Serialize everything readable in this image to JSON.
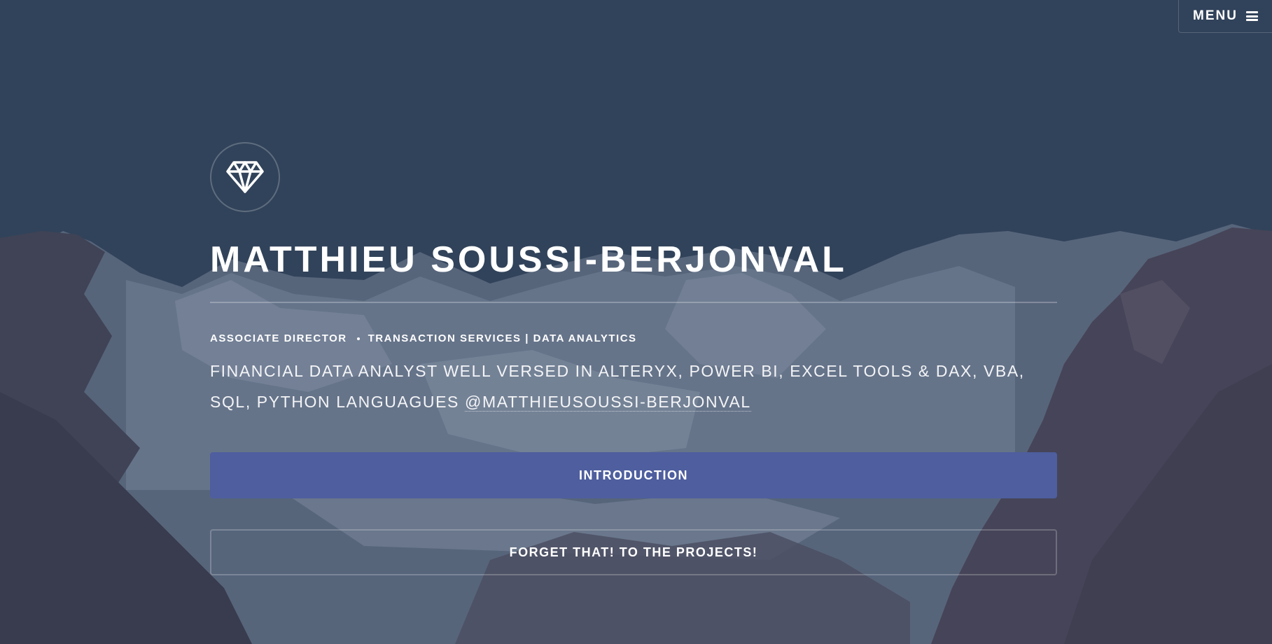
{
  "nav": {
    "menu_label": "MENU",
    "menu_icon": "hamburger-icon"
  },
  "hero": {
    "logo_icon": "diamond-icon",
    "name": "MATTHIEU SOUSSI-BERJONVAL",
    "role": "ASSOCIATE DIRECTOR",
    "department": "TRANSACTION SERVICES | DATA ANALYTICS",
    "description_text": "FINANCIAL DATA ANALYST WELL VERSED IN ALTERYX, POWER BI, EXCEL TOOLS & DAX, VBA, SQL, PYTHON LANGUAGUES ",
    "handle": "@MATTHIEUSOUSSI-BERJONVAL"
  },
  "actions": {
    "primary_label": "INTRODUCTION",
    "secondary_label": "FORGET THAT! TO THE PROJECTS!"
  },
  "colors": {
    "background": "#34465c",
    "primary_button": "#4e5e9e",
    "text": "#ffffff"
  }
}
